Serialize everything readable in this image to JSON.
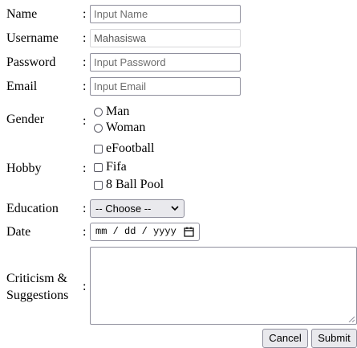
{
  "form": {
    "name": {
      "label": "Name",
      "colon": ":",
      "placeholder": "Input Name"
    },
    "username": {
      "label": "Username",
      "colon": ":",
      "value": "Mahasiswa"
    },
    "password": {
      "label": "Password",
      "colon": ":",
      "placeholder": "Input Password"
    },
    "email": {
      "label": "Email",
      "colon": ":",
      "placeholder": "Input Email"
    },
    "gender": {
      "label": "Gender",
      "colon": ":",
      "options": [
        "Man",
        "Woman"
      ]
    },
    "hobby": {
      "label": "Hobby",
      "colon": ":",
      "options": [
        "eFootball",
        "Fifa",
        "8 Ball Pool"
      ]
    },
    "education": {
      "label": "Education",
      "colon": ":",
      "selected": "-- Choose --"
    },
    "date": {
      "label": "Date",
      "colon": ":",
      "placeholder": "mm / dd / yyyy"
    },
    "criticism": {
      "label_line1": "Criticism &",
      "label_line2": "Suggestions",
      "colon": ":"
    },
    "buttons": {
      "cancel": "Cancel",
      "submit": "Submit"
    }
  }
}
